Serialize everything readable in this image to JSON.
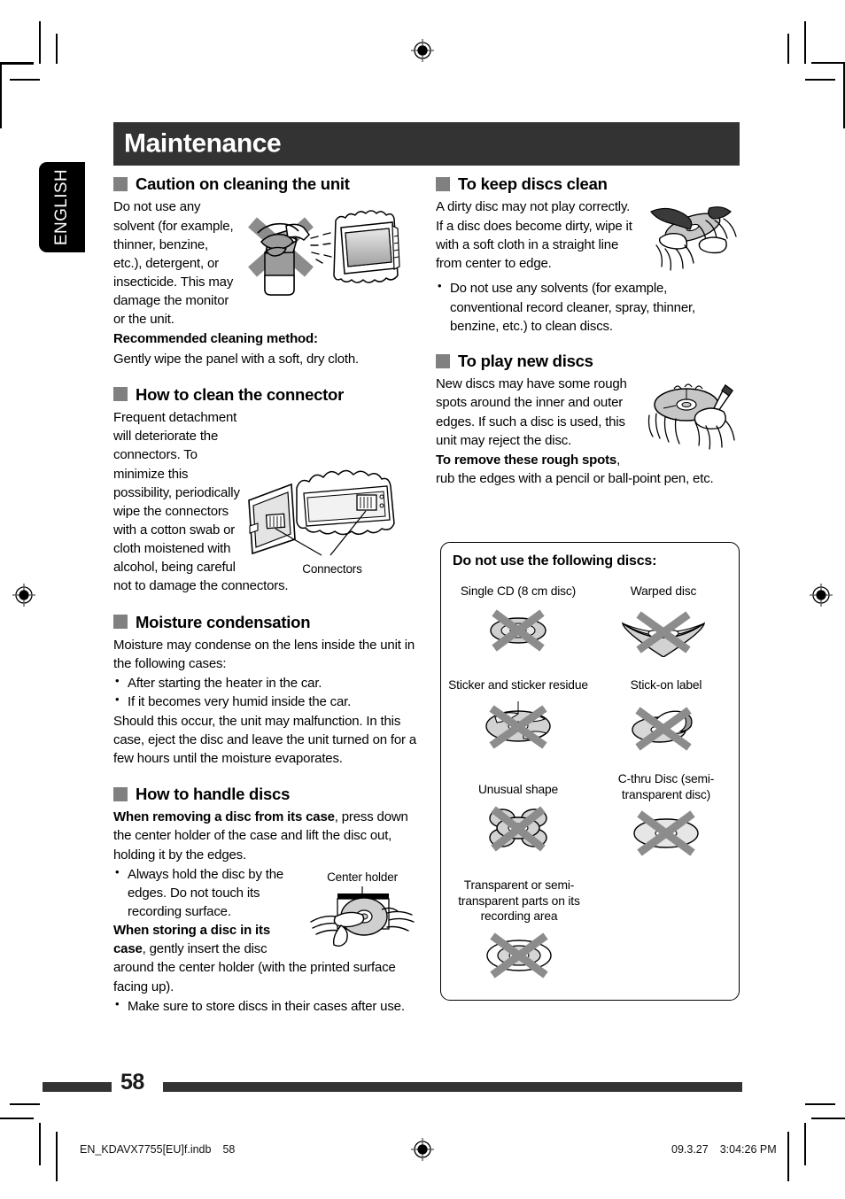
{
  "page": {
    "chapter_title": "Maintenance",
    "language_tab": "ENGLISH",
    "page_number": "58"
  },
  "footer": {
    "file_name": "EN_KDAVX7755[EU]f.indb",
    "file_page": "58",
    "date": "09.3.27",
    "time": "3:04:26 PM"
  },
  "left_column": {
    "sections": [
      {
        "heading": "Caution on cleaning the unit",
        "body_1": "Do not use any solvent (for example, thinner, benzine, etc.), detergent, or insecticide. This may damage the monitor or the unit.",
        "bold_lead": "Recommended cleaning method:",
        "body_2": "Gently wipe the panel with a soft, dry cloth.",
        "figure": "spray-bottle-crossed-out-on-monitor"
      },
      {
        "heading": "How to clean the connector",
        "body_1": "Frequent detachment will deteriorate the connectors. To minimize this possibility, periodically wipe the connectors with a cotton swab or cloth moistened with alcohol, being careful not to damage the connectors.",
        "figure": "detachable-faceplate-rear-connectors",
        "figure_caption": "Connectors"
      },
      {
        "heading": "Moisture condensation",
        "body_1": "Moisture may condense on the lens inside the unit in the following cases:",
        "bullets": [
          "After starting the heater in the car.",
          "If it becomes very humid inside the car."
        ],
        "body_2": "Should this occur, the unit may malfunction. In this case, eject the disc and leave the unit turned on for a few hours until the moisture evaporates."
      },
      {
        "heading": "How to handle discs",
        "bold_lead_1": "When removing a disc from its case",
        "body_1": ", press down the center holder of the case and lift the disc out, holding it by the edges.",
        "bullets_1": [
          "Always hold the disc by the edges. Do not touch its recording surface."
        ],
        "bold_lead_2": "When storing a disc in its case",
        "body_2": ", gently insert the disc around the center holder (with the printed surface facing up).",
        "bullets_2": [
          "Make sure to store discs in their cases after use."
        ],
        "figure": "hand-removing-disc-from-case",
        "figure_caption": "Center holder"
      }
    ]
  },
  "right_column": {
    "sections": [
      {
        "heading": "To keep discs clean",
        "body_1": "A dirty disc may not play correctly. If a disc does become dirty, wipe it with a soft cloth in a straight line from center to edge.",
        "bullets": [
          "Do not use any solvents (for example, conventional record cleaner, spray, thinner, benzine, etc.) to clean discs."
        ],
        "figure": "hand-wiping-disc-with-cloth"
      },
      {
        "heading": "To play new discs",
        "body_1": "New discs may have some rough spots around the inner and outer edges. If such a disc is used, this unit may reject the disc.",
        "bold_lead": "To remove these rough spots",
        "body_2": ", rub the edges with a pencil or ball-point pen, etc.",
        "figure": "hand-rubbing-disc-edge-with-pen"
      }
    ],
    "disc_box": {
      "title": "Do not use the following discs:",
      "items": [
        {
          "caption": "Single CD (8 cm disc)",
          "art": "small-disc-crossed-out"
        },
        {
          "caption": "Warped disc",
          "art": "warped-disc-crossed-out"
        },
        {
          "caption": "Sticker and sticker residue",
          "art": "disc-with-stickers-crossed-out"
        },
        {
          "caption": "Stick-on label",
          "art": "disc-with-stick-on-label-crossed-out"
        },
        {
          "caption": "Unusual shape",
          "art": "flower-shaped-disc-crossed-out"
        },
        {
          "caption": "C-thru Disc (semi-transparent disc)",
          "art": "semi-transparent-disc-crossed-out"
        },
        {
          "caption": "Transparent or semi-transparent parts on its recording area",
          "art": "transparent-recording-area-disc-crossed-out"
        }
      ]
    }
  }
}
